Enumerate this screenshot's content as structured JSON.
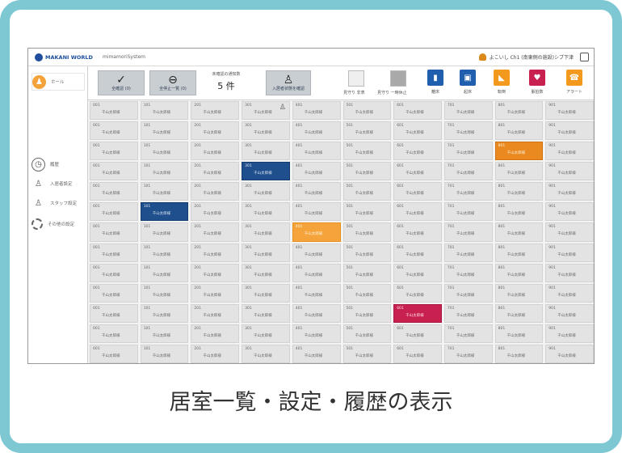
{
  "app": {
    "logo_text": "MAKANI WORLD",
    "system_name": "mimamoriSystem",
    "user_text": "よこいし Ch1 (南東側の施設)シブ下津"
  },
  "sidebar": {
    "items": [
      {
        "label": "ホール",
        "icon": "person-icon",
        "active": true
      },
      {
        "label": "履歴",
        "icon": "history-icon",
        "active": false
      },
      {
        "label": "入居者設定",
        "icon": "resident-icon",
        "active": false
      },
      {
        "label": "スタッフ設定",
        "icon": "staff-icon",
        "active": false
      },
      {
        "label": "その他の設定",
        "icon": "gear-icon",
        "active": false
      }
    ]
  },
  "toolbar": {
    "confirm_label": "全確認 (0)",
    "stop_label": "全停止一覧 (0)",
    "counter_label": "未確認の通知数",
    "counter_value": "5 件",
    "resident_button_label": "入居者状態を確認",
    "filter_left_label": "見守り 非表",
    "filter_right_label": "見守り 一時休止",
    "mode_buttons": [
      {
        "label": "離床",
        "color": "#1f5fae",
        "icon": "bed-exit-icon"
      },
      {
        "label": "起床",
        "color": "#1f5fae",
        "icon": "wake-icon"
      },
      {
        "label": "転倒",
        "color": "#f39a1e",
        "icon": "fall-icon"
      },
      {
        "label": "脈拍数",
        "color": "#c8204f",
        "icon": "pulse-icon"
      },
      {
        "label": "アラート",
        "color": "#f39a1e",
        "icon": "alert-icon"
      }
    ]
  },
  "grid": {
    "columns": [
      "001",
      "101",
      "201",
      "301",
      "401",
      "501",
      "601",
      "701",
      "801",
      "901"
    ],
    "default_name": "千山太郎様",
    "highlights": [
      {
        "row": 2,
        "col": 8,
        "status": "dark-orange"
      },
      {
        "row": 3,
        "col": 3,
        "status": "blue"
      },
      {
        "row": 5,
        "col": 1,
        "status": "blue"
      },
      {
        "row": 6,
        "col": 4,
        "status": "orange"
      },
      {
        "row": 10,
        "col": 6,
        "status": "magenta"
      }
    ],
    "icon_cells": [
      {
        "row": 0,
        "col": 3,
        "icon": "person-icon"
      }
    ]
  },
  "caption": "居室一覧・設定・履歴の表示"
}
